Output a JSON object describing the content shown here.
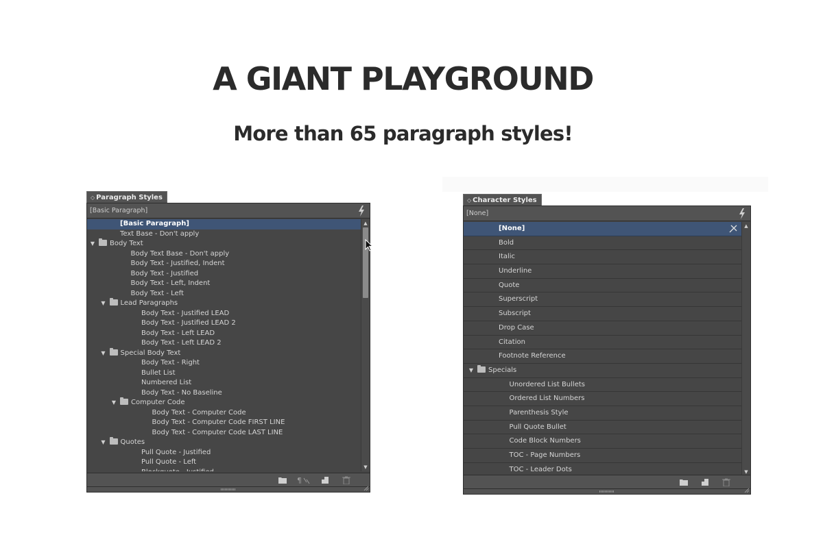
{
  "hero": {
    "title": "A GIANT PLAYGROUND",
    "subtitle": "More than 65 paragraph styles!"
  },
  "paragraph_panel": {
    "tab_arrows": "◇",
    "tab_label": "Paragraph Styles",
    "current_style": "[Basic Paragraph]",
    "scroll_up": "▲",
    "scroll_down": "▼",
    "items": [
      {
        "label": "[Basic Paragraph]",
        "level": 2,
        "folder": false,
        "selected": true
      },
      {
        "label": "Text Base - Don't apply",
        "level": 2,
        "folder": false
      },
      {
        "label": "Body Text",
        "level": 0,
        "folder": true,
        "arrow": "▼"
      },
      {
        "label": "Body Text Base - Don't apply",
        "level": 3,
        "folder": false
      },
      {
        "label": "Body Text - Justified, Indent",
        "level": 3,
        "folder": false
      },
      {
        "label": "Body Text - Justified",
        "level": 3,
        "folder": false
      },
      {
        "label": "Body Text - Left, Indent",
        "level": 3,
        "folder": false
      },
      {
        "label": "Body Text - Left",
        "level": 3,
        "folder": false
      },
      {
        "label": "Lead Paragraphs",
        "level": 1,
        "folder": true,
        "arrow": "▼"
      },
      {
        "label": "Body Text - Justified LEAD",
        "level": 4,
        "folder": false
      },
      {
        "label": "Body Text - Justified LEAD 2",
        "level": 4,
        "folder": false
      },
      {
        "label": "Body Text - Left LEAD",
        "level": 4,
        "folder": false
      },
      {
        "label": "Body Text - Left LEAD 2",
        "level": 4,
        "folder": false
      },
      {
        "label": "Special Body Text",
        "level": 1,
        "folder": true,
        "arrow": "▼"
      },
      {
        "label": "Body Text - Right",
        "level": 4,
        "folder": false
      },
      {
        "label": "Bullet List",
        "level": 4,
        "folder": false
      },
      {
        "label": "Numbered List",
        "level": 4,
        "folder": false
      },
      {
        "label": "Body Text - No Baseline",
        "level": 4,
        "folder": false
      },
      {
        "label": "Computer Code",
        "level": 2,
        "folder": true,
        "arrow": "▼"
      },
      {
        "label": "Body Text - Computer Code",
        "level": 5,
        "folder": false
      },
      {
        "label": "Body Text - Computer Code FIRST LINE",
        "level": 5,
        "folder": false
      },
      {
        "label": "Body Text - Computer Code LAST LINE",
        "level": 5,
        "folder": false
      },
      {
        "label": "Quotes",
        "level": 1,
        "folder": true,
        "arrow": "▼"
      },
      {
        "label": "Pull Quote - Justified",
        "level": 4,
        "folder": false
      },
      {
        "label": "Pull Quote - Left",
        "level": 4,
        "folder": false
      },
      {
        "label": "Blockquote - Justified",
        "level": 4,
        "folder": false
      }
    ],
    "scroll_position": 0.0,
    "scroll_visible_fraction": 0.3
  },
  "character_panel": {
    "tab_arrows": "◇",
    "tab_label": "Character Styles",
    "current_style": "[None]",
    "scroll_up": "▲",
    "scroll_down": "▼",
    "items": [
      {
        "label": "[None]",
        "level": 2,
        "folder": false,
        "selected": true
      },
      {
        "label": "Bold",
        "level": 2,
        "folder": false
      },
      {
        "label": "Italic",
        "level": 2,
        "folder": false
      },
      {
        "label": "Underline",
        "level": 2,
        "folder": false
      },
      {
        "label": "Quote",
        "level": 2,
        "folder": false
      },
      {
        "label": "Superscript",
        "level": 2,
        "folder": false
      },
      {
        "label": "Subscript",
        "level": 2,
        "folder": false
      },
      {
        "label": "Drop Case",
        "level": 2,
        "folder": false
      },
      {
        "label": "Citation",
        "level": 2,
        "folder": false
      },
      {
        "label": "Footnote Reference",
        "level": 2,
        "folder": false
      },
      {
        "label": "Specials",
        "level": 0,
        "folder": true,
        "arrow": "▼"
      },
      {
        "label": "Unordered List Bullets",
        "level": 3,
        "folder": false
      },
      {
        "label": "Ordered List Numbers",
        "level": 3,
        "folder": false
      },
      {
        "label": "Parenthesis Style",
        "level": 3,
        "folder": false
      },
      {
        "label": "Pull Quote Bullet",
        "level": 3,
        "folder": false
      },
      {
        "label": "Code Block Numbers",
        "level": 3,
        "folder": false
      },
      {
        "label": "TOC - Page Numbers",
        "level": 3,
        "folder": false
      },
      {
        "label": "TOC - Leader Dots",
        "level": 3,
        "folder": false
      }
    ]
  },
  "icons": {
    "bolt": "lightning-bolt-icon",
    "new_group": "folder-icon",
    "clear_overrides": "paragraph-clear-overrides-icon",
    "new_style": "new-style-icon",
    "delete": "trash-icon",
    "selected_marker": "pen-override-icon"
  },
  "colors": {
    "panel_bg": "#464646",
    "panel_header": "#535353",
    "selection": "#3f5576",
    "text": "#d6d6d6",
    "heading": "#2b2b2b"
  }
}
